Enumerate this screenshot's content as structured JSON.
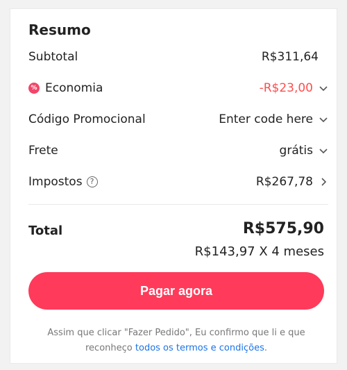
{
  "summary": {
    "title": "Resumo",
    "subtotal_label": "Subtotal",
    "subtotal_value": "R$311,64",
    "savings_label": "Economia",
    "savings_value": "-R$23,00",
    "promo_label": "Código Promocional",
    "promo_placeholder": "Enter code here",
    "shipping_label": "Frete",
    "shipping_value": "grátis",
    "taxes_label": "Impostos",
    "taxes_value": "R$267,78",
    "total_label": "Total",
    "total_value": "R$575,90",
    "installment_text": "R$143,97 X 4 meses",
    "pay_button_label": "Pagar agora",
    "legal_text_prefix": "Assim que clicar \"Fazer Pedido\", Eu confirmo que li e que reconheço",
    "legal_link_text": "todos os termos e condições",
    "legal_text_suffix": "."
  },
  "colors": {
    "accent": "#ff3a5a",
    "discount": "#ff4d4d",
    "link": "#1a73e8"
  },
  "icons": {
    "discount": "discount-badge-icon",
    "help": "question-circle-icon",
    "chevron_down": "chevron-down-icon",
    "chevron_right": "chevron-right-icon"
  }
}
